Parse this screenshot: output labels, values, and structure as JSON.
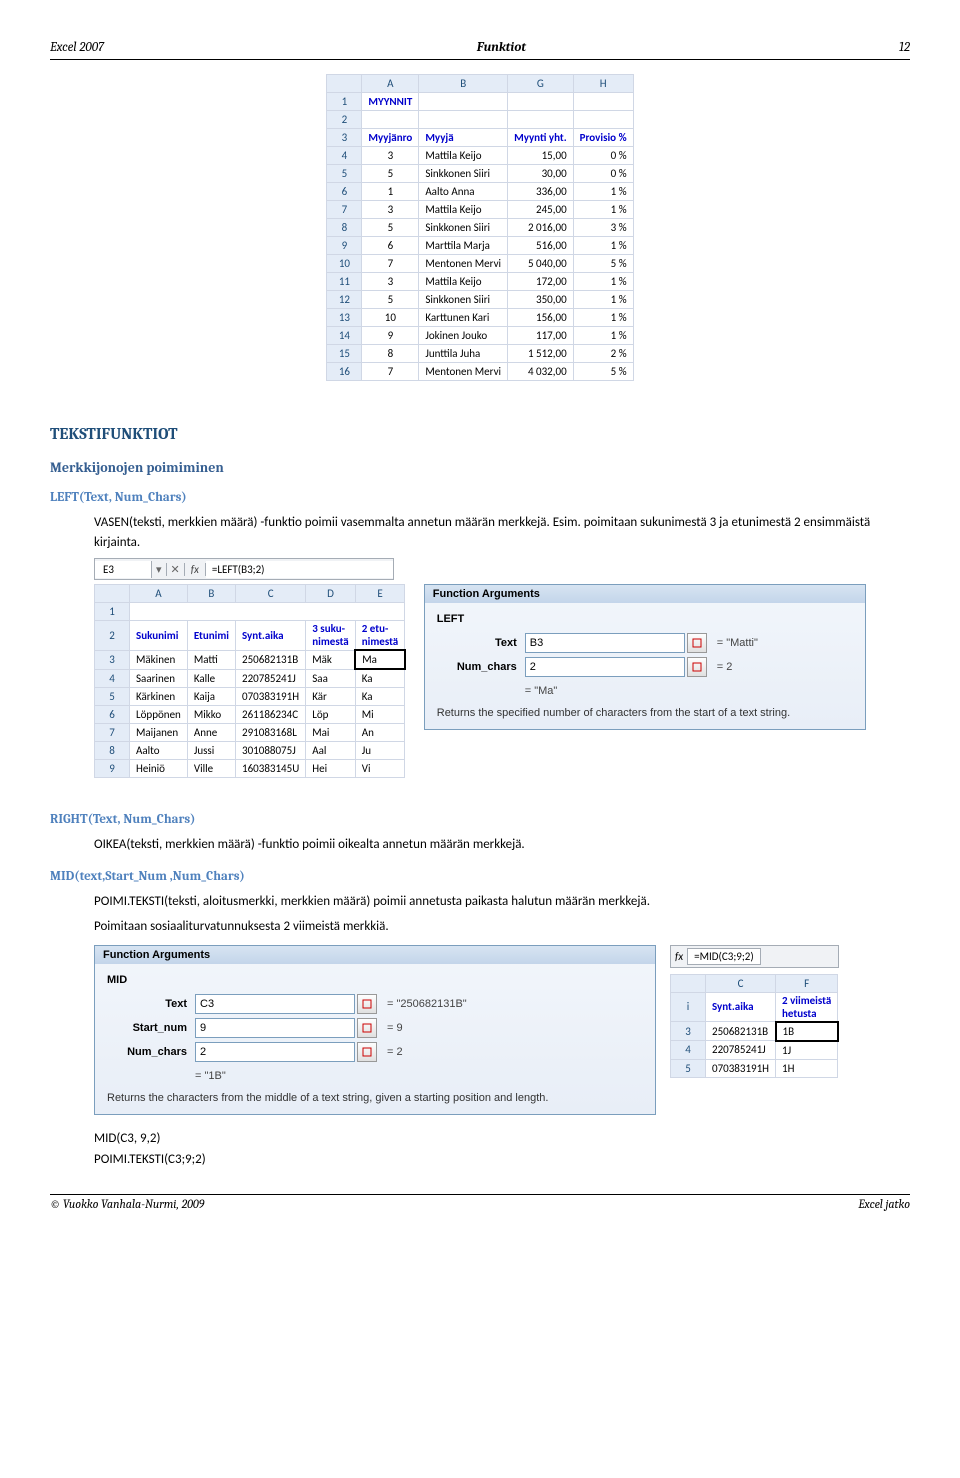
{
  "header": {
    "left": "Excel 2007",
    "center": "Funktiot",
    "right": "12"
  },
  "table1": {
    "cols": [
      "",
      "A",
      "B",
      "G",
      "H"
    ],
    "title_cell": "MYYNNIT",
    "row3": {
      "a": "Myyjänro",
      "b": "Myyjä",
      "g": "Myynti yht.",
      "h": "Provisio %"
    },
    "rows": [
      {
        "n": "4",
        "a": "3",
        "b": "Mattila Keijo",
        "g": "15,00",
        "h": "0 %"
      },
      {
        "n": "5",
        "a": "5",
        "b": "Sinkkonen Siiri",
        "g": "30,00",
        "h": "0 %"
      },
      {
        "n": "6",
        "a": "1",
        "b": "Aalto Anna",
        "g": "336,00",
        "h": "1 %"
      },
      {
        "n": "7",
        "a": "3",
        "b": "Mattila Keijo",
        "g": "245,00",
        "h": "1 %"
      },
      {
        "n": "8",
        "a": "5",
        "b": "Sinkkonen Siiri",
        "g": "2 016,00",
        "h": "3 %"
      },
      {
        "n": "9",
        "a": "6",
        "b": "Marttila Marja",
        "g": "516,00",
        "h": "1 %"
      },
      {
        "n": "10",
        "a": "7",
        "b": "Mentonen Mervi",
        "g": "5 040,00",
        "h": "5 %"
      },
      {
        "n": "11",
        "a": "3",
        "b": "Mattila Keijo",
        "g": "172,00",
        "h": "1 %"
      },
      {
        "n": "12",
        "a": "5",
        "b": "Sinkkonen Siiri",
        "g": "350,00",
        "h": "1 %"
      },
      {
        "n": "13",
        "a": "10",
        "b": "Karttunen Kari",
        "g": "156,00",
        "h": "1 %"
      },
      {
        "n": "14",
        "a": "9",
        "b": "Jokinen Jouko",
        "g": "117,00",
        "h": "1 %"
      },
      {
        "n": "15",
        "a": "8",
        "b": "Junttila Juha",
        "g": "1 512,00",
        "h": "2 %"
      },
      {
        "n": "16",
        "a": "7",
        "b": "Mentonen Mervi",
        "g": "4 032,00",
        "h": "5 %"
      }
    ]
  },
  "h_funcs": "TEKSTIFUNKTIOT",
  "h_poim": "Merkkijonojen poimiminen",
  "h_left": "LEFT(Text, Num_Chars)",
  "left_p1": "VASEN(teksti, merkkien määrä)  -funktio poimii vasemmalta annetun määrän merkkejä. Esim. poimitaan sukunimestä 3 ja etunimestä 2 ensimmäistä kirjainta.",
  "fbar1": {
    "name": "E3",
    "fx": "fx",
    "formula": "=LEFT(B3;2)"
  },
  "table2": {
    "cols": [
      "",
      "A",
      "B",
      "C",
      "D",
      "E"
    ],
    "row2": {
      "a": "Sukunimi",
      "b": "Etunimi",
      "c": "Synt.aika",
      "d": "3 suku-\nnimestä",
      "e": "2 etu-\nnimestä"
    },
    "rows": [
      {
        "n": "3",
        "a": "Mäkinen",
        "b": "Matti",
        "c": "250682131B",
        "d": "Mäk",
        "e": "Ma"
      },
      {
        "n": "4",
        "a": "Saarinen",
        "b": "Kalle",
        "c": "220785241J",
        "d": "Saa",
        "e": "Ka"
      },
      {
        "n": "5",
        "a": "Kärkinen",
        "b": "Kaija",
        "c": "070383191H",
        "d": "Kär",
        "e": "Ka"
      },
      {
        "n": "6",
        "a": "Löppönen",
        "b": "Mikko",
        "c": "261186234C",
        "d": "Löp",
        "e": "Mi"
      },
      {
        "n": "7",
        "a": "Maijanen",
        "b": "Anne",
        "c": "291083168L",
        "d": "Mai",
        "e": "An"
      },
      {
        "n": "8",
        "a": "Aalto",
        "b": "Jussi",
        "c": "301088075J",
        "d": "Aal",
        "e": "Ju"
      },
      {
        "n": "9",
        "a": "Heiniö",
        "b": "Ville",
        "c": "160383145U",
        "d": "Hei",
        "e": "Vi"
      }
    ]
  },
  "dlg_left": {
    "title": "Function Arguments",
    "fn": "LEFT",
    "text_label": "Text",
    "text_val": "B3",
    "text_eq": "= \"Matti\"",
    "num_label": "Num_chars",
    "num_val": "2",
    "num_eq": "= 2",
    "ret": "= \"Ma\"",
    "desc": "Returns the specified number of characters from the start of a text string."
  },
  "h_right": "RIGHT(Text, Num_Chars)",
  "right_p": "OIKEA(teksti, merkkien määrä)  -funktio poimii oikealta annetun määrän merkkejä.",
  "h_mid": "MID(text,Start_Num ,Num_Chars)",
  "mid_p1": "POIMI.TEKSTI(teksti, aloitusmerkki, merkkien määrä)  poimii annetusta paikasta halutun määrän merkkejä.",
  "mid_p2": "Poimitaan sosiaaliturvatunnuksesta 2 viimeistä merkkiä.",
  "fbar2": {
    "fx": "fx",
    "formula": "=MID(C3;9;2)"
  },
  "dlg_mid": {
    "title": "Function Arguments",
    "fn": "MID",
    "text_label": "Text",
    "text_val": "C3",
    "text_eq": "= \"250682131B\"",
    "start_label": "Start_num",
    "start_val": "9",
    "start_eq": "= 9",
    "num_label": "Num_chars",
    "num_val": "2",
    "num_eq": "= 2",
    "ret": "= \"1B\"",
    "desc": "Returns the characters from the middle of a text string, given a starting position and length."
  },
  "table3": {
    "cols": [
      "",
      "C",
      "F"
    ],
    "row2": {
      "c": "Synt.aika",
      "f": "2 viimeistä\nhetusta"
    },
    "rows": [
      {
        "n": "3",
        "c": "250682131B",
        "f": "1B"
      },
      {
        "n": "4",
        "c": "220785241J",
        "f": "1J"
      },
      {
        "n": "5",
        "c": "070383191H",
        "f": "1H"
      }
    ],
    "lefti": "i"
  },
  "formulas_end": {
    "l1": "MID(C3, 9,2)",
    "l2": "POIMI.TEKSTI(C3;9;2)"
  },
  "footer": {
    "left": "© Vuokko Vanhala-Nurmi, 2009",
    "right": "Excel jatko"
  }
}
